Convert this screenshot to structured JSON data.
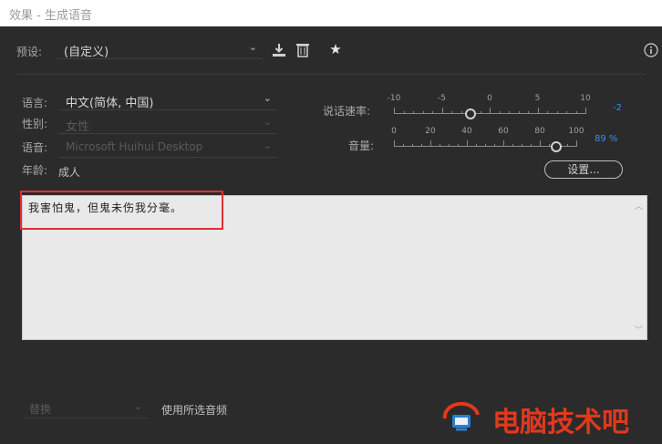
{
  "window": {
    "title": "效果 - 生成语音"
  },
  "preset": {
    "label": "预设:",
    "value": "(自定义)"
  },
  "language": {
    "label": "语言:",
    "value": "中文(简体, 中国)"
  },
  "gender": {
    "label": "性别:",
    "value": "女性"
  },
  "voice": {
    "label": "语音:",
    "value": "Microsoft Huihui Desktop"
  },
  "age": {
    "label": "年龄:",
    "value": "成人"
  },
  "rate": {
    "label": "说话速率:",
    "min": -10,
    "max": 10,
    "tick_labels": [
      "-10",
      "-5",
      "0",
      "5",
      "10"
    ],
    "value": -2,
    "value_text": "-2"
  },
  "volume": {
    "label": "音量:",
    "min": 0,
    "max": 100,
    "tick_labels": [
      "0",
      "20",
      "40",
      "60",
      "80",
      "100"
    ],
    "value": 89,
    "value_text": "89 %"
  },
  "settings_button": "设置...",
  "text_input": {
    "value": "我害怕鬼，但鬼未伤我分毫。"
  },
  "bottom": {
    "replace_dropdown": "替换",
    "use_selected_audio": "使用所选音频"
  },
  "watermark": {
    "text": "电脑技术吧"
  },
  "colors": {
    "accent": "#3d8cf0",
    "highlight": "#e03030",
    "watermark": "#e0391c"
  },
  "icons": [
    "import-icon",
    "delete-icon",
    "favorite-star-icon",
    "info-icon",
    "chevron-down-icon"
  ]
}
